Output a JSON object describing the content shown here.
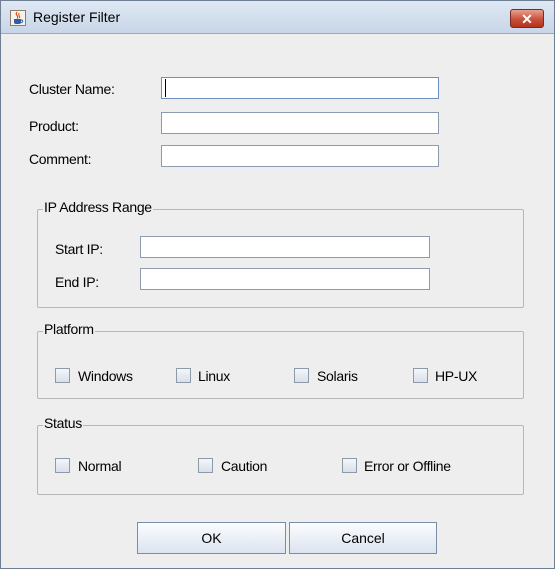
{
  "window": {
    "title": "Register Filter",
    "close_symbol": "✕",
    "icon": "java-cup-icon"
  },
  "form": {
    "cluster_name_label": "Cluster Name:",
    "cluster_name_value": "",
    "product_label": "Product:",
    "product_value": "",
    "comment_label": "Comment:",
    "comment_value": ""
  },
  "ip_range": {
    "legend": "IP Address Range",
    "start_label": "Start IP:",
    "start_value": "",
    "end_label": "End IP:",
    "end_value": ""
  },
  "platform": {
    "legend": "Platform",
    "options": [
      "Windows",
      "Linux",
      "Solaris",
      "HP-UX"
    ]
  },
  "status": {
    "legend": "Status",
    "options": [
      "Normal",
      "Caution",
      "Error or Offline"
    ]
  },
  "buttons": {
    "ok": "OK",
    "cancel": "Cancel"
  }
}
